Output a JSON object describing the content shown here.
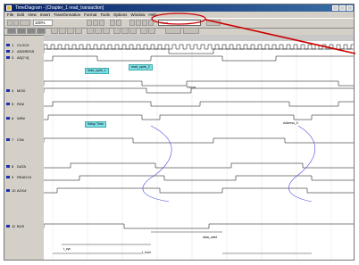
{
  "window": {
    "title": "TimeDiagram - [Chapter_1 read_transaction]"
  },
  "menu": [
    "File",
    "Edit",
    "View",
    "Insert",
    "Transformation",
    "Format",
    "Tools",
    "Options",
    "Window",
    "Help"
  ],
  "toolbar": {
    "zoom_label": "100%",
    "find_value": "Find"
  },
  "colors": {
    "accent": "#cc0000",
    "signal_icon": "#1a2fb0",
    "note_bg": "#7fe0e8",
    "waveform": "#000000",
    "causal_curve": "#4b4bdd",
    "title_bar": "#0a246a"
  },
  "signals": [
    {
      "num": "1",
      "name": "CLOCK"
    },
    {
      "num": "2",
      "name": "ADDRESS"
    },
    {
      "num": "3",
      "name": "AD[7:0]"
    },
    {
      "num": "4",
      "name": "MOD"
    },
    {
      "num": "5",
      "name": "RD#"
    },
    {
      "num": "6",
      "name": "WR#"
    },
    {
      "num": "7",
      "name": "CS#"
    },
    {
      "num": "8",
      "name": "DATA"
    },
    {
      "num": "9",
      "name": "READY#"
    },
    {
      "num": "10",
      "name": "ACK#"
    },
    {
      "num": "11",
      "name": "BUS"
    }
  ],
  "notes": [
    "read_cycle_1",
    "read_cycle_2",
    "Setup Time"
  ],
  "labels": {
    "tcyc": "t_cyc",
    "data": "data_valid",
    "hold": "t_hold",
    "addr": "Address_0",
    "period": "Period"
  }
}
